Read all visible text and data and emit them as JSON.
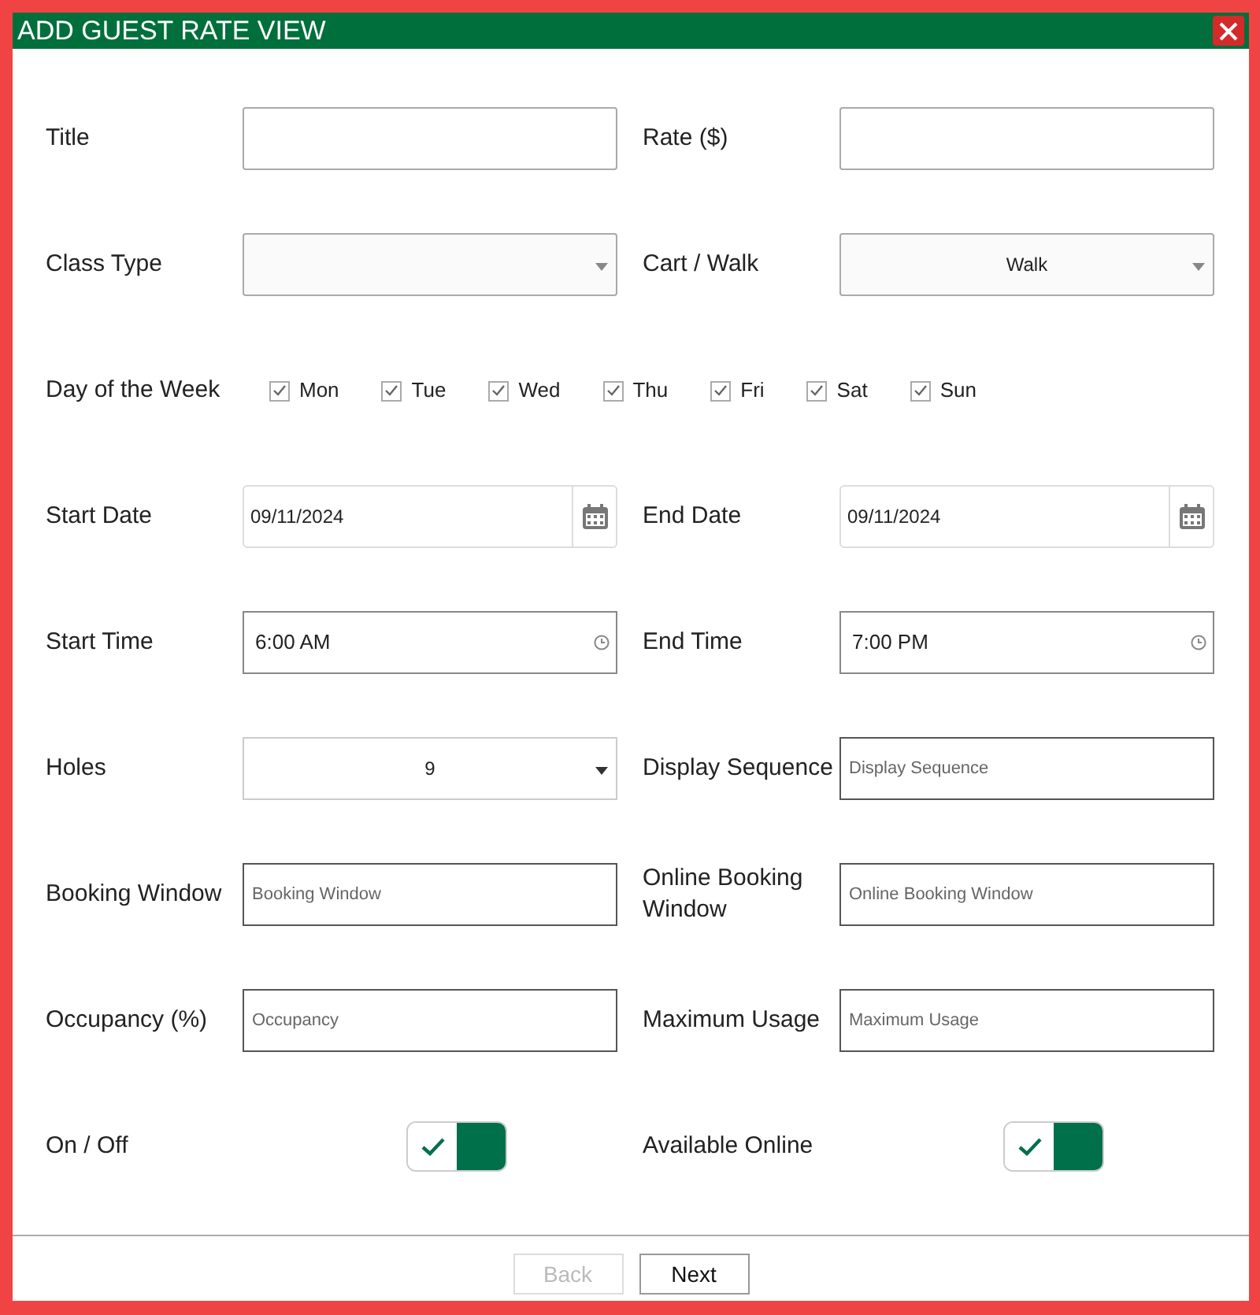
{
  "dialog": {
    "title": "ADD GUEST RATE VIEW"
  },
  "rows": [
    {
      "kind": "fields",
      "fields": [
        {
          "label": "Title",
          "kind": "text"
        },
        {
          "label": "Rate ($)",
          "kind": "text"
        }
      ]
    },
    {
      "kind": "fields",
      "fields": [
        {
          "label": "Class Type",
          "kind": "select"
        },
        {
          "label": "Cart / Walk",
          "kind": "select",
          "value": "Walk"
        }
      ]
    },
    {
      "kind": "days",
      "label": "Day of the Week",
      "days": [
        {
          "label": "Mon",
          "checked": true
        },
        {
          "label": "Tue",
          "checked": true
        },
        {
          "label": "Wed",
          "checked": true
        },
        {
          "label": "Thu",
          "checked": true
        },
        {
          "label": "Fri",
          "checked": true
        },
        {
          "label": "Sat",
          "checked": true
        },
        {
          "label": "Sun",
          "checked": true
        }
      ]
    },
    {
      "kind": "fields",
      "fields": [
        {
          "label": "Start Date",
          "kind": "date",
          "value": "09/11/2024"
        },
        {
          "label": "End Date",
          "kind": "date",
          "value": "09/11/2024"
        }
      ]
    },
    {
      "kind": "fields",
      "fields": [
        {
          "label": "Start Time",
          "kind": "time",
          "value": "6:00 AM"
        },
        {
          "label": "End Time",
          "kind": "time",
          "value": "7:00 PM"
        }
      ]
    },
    {
      "kind": "fields",
      "fields": [
        {
          "label": "Holes",
          "kind": "dropdown",
          "value": "9"
        },
        {
          "label": "Display Sequence",
          "kind": "input",
          "placeholder": "Display Sequence"
        }
      ]
    },
    {
      "kind": "fields",
      "fields": [
        {
          "label": "Booking Window",
          "kind": "input",
          "placeholder": "Booking Window"
        },
        {
          "label": "Online Booking Window",
          "kind": "input",
          "placeholder": "Online Booking Window"
        }
      ]
    },
    {
      "kind": "fields",
      "fields": [
        {
          "label": "Occupancy (%)",
          "kind": "input",
          "placeholder": "Occupancy"
        },
        {
          "label": "Maximum Usage",
          "kind": "input",
          "placeholder": "Maximum Usage"
        }
      ]
    },
    {
      "kind": "fields",
      "fields": [
        {
          "label": "On / Off",
          "kind": "toggle",
          "on": true
        },
        {
          "label": "Available Online",
          "kind": "toggle",
          "on": true
        }
      ]
    }
  ],
  "buttons": [
    {
      "label": "Back",
      "disabled": true
    },
    {
      "label": "Next",
      "disabled": false
    }
  ]
}
